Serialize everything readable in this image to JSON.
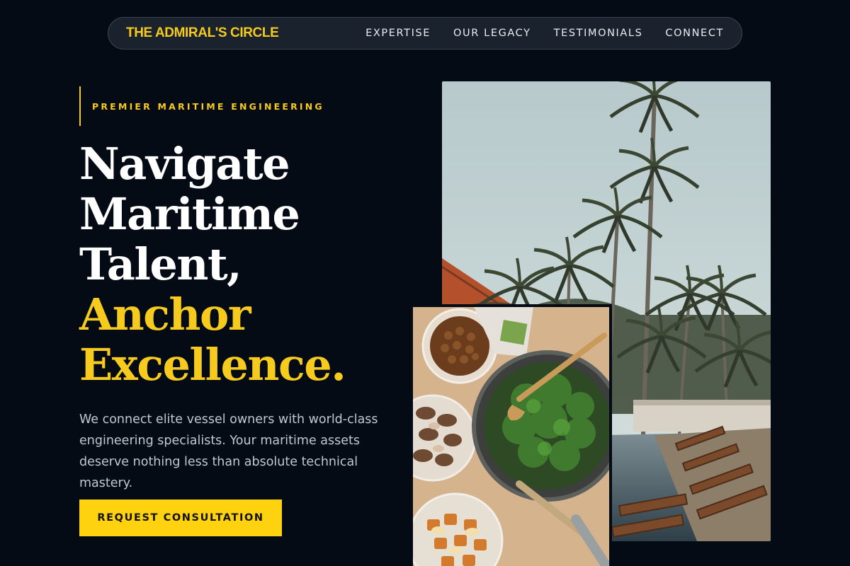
{
  "brand": {
    "name": "THE ADMIRAL'S CIRCLE"
  },
  "nav": {
    "items": [
      {
        "label": "EXPERTISE"
      },
      {
        "label": "OUR LEGACY"
      },
      {
        "label": "TESTIMONIALS"
      },
      {
        "label": "CONNECT"
      }
    ]
  },
  "hero": {
    "eyebrow": "PREMIER MARITIME ENGINEERING",
    "headline": {
      "line1": "Navigate",
      "line2": "Maritime",
      "line3": "Talent,",
      "line4": "Anchor",
      "line5": "Excellence."
    },
    "lead": "We connect elite vessel owners with world-class engineering specialists. Your maritime assets deserve nothing less than absolute technical mastery.",
    "cta_label": "REQUEST CONSULTATION"
  },
  "colors": {
    "background": "#050b14",
    "accent": "#f6cb1e",
    "nav_background": "#1a222d"
  }
}
